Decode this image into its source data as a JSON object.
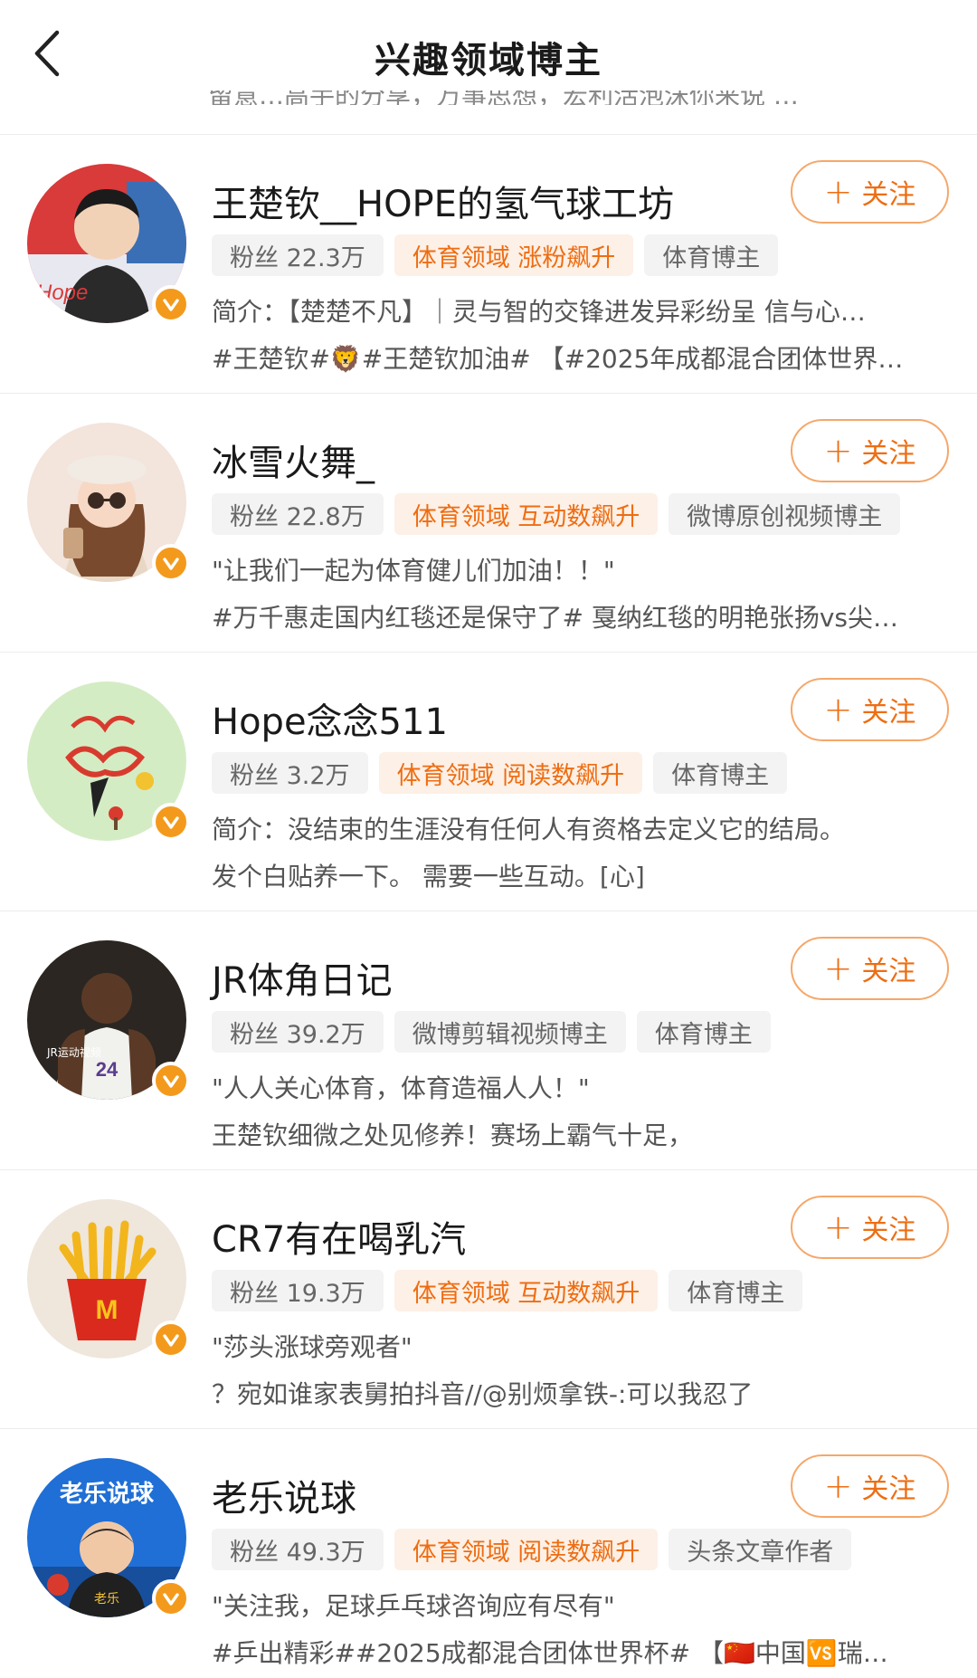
{
  "header": {
    "title": "兴趣领域博主",
    "partial_text": "留意…高手的分享，万事思想，宏利活泡沫你来说 …"
  },
  "follow_label": "关注",
  "accounts": [
    {
      "name": "王楚钦__HOPE的氢气球工坊",
      "fans": "粉丝 22.3万",
      "highlight": "体育领域 涨粉飙升",
      "category": "体育博主",
      "line1": "简介：【楚楚不凡】｜灵与智的交锋进发异彩纷呈 信与心…",
      "line2": "#王楚钦#🦁#王楚钦加油# 【#2025年成都混合团体世界…"
    },
    {
      "name": "冰雪火舞_",
      "fans": "粉丝 22.8万",
      "highlight": "体育领域 互动数飙升",
      "category": "微博原创视频博主",
      "line1": "\"让我们一起为体育健儿们加油！！\"",
      "line2": "#万千惠走国内红毯还是保守了# 戛纳红毯的明艳张扬vs尖…"
    },
    {
      "name": "Hope念念511",
      "fans": "粉丝 3.2万",
      "highlight": "体育领域 阅读数飙升",
      "category": "体育博主",
      "line1": "简介：没结束的生涯没有任何人有资格去定义它的结局。",
      "line2": "发个白贴养一下。 需要一些互动。[心]"
    },
    {
      "name": "JR体角日记",
      "fans": "粉丝 39.2万",
      "highlight": "微博剪辑视频博主",
      "category": "体育博主",
      "line1": "\"人人关心体育，体育造福人人！\"",
      "line2": "王楚钦细微之处见修养！赛场上霸气十足，",
      "avatar_caption": "JR运动视频"
    },
    {
      "name": "CR7有在喝乳汽",
      "fans": "粉丝 19.3万",
      "highlight": "体育领域 互动数飙升",
      "category": "体育博主",
      "line1": "\"莎头涨球旁观者\"",
      "line2": "？宛如谁家表舅拍抖音//@别烦拿铁-:可以我忍了"
    },
    {
      "name": "老乐说球",
      "fans": "粉丝 49.3万",
      "highlight": "体育领域 阅读数飙升",
      "category": "头条文章作者",
      "line1": "\"关注我，足球乒乓球咨询应有尽有\"",
      "line2": "#乒出精彩##2025成都混合团体世界杯# 【🇨🇳中国🆚瑞…",
      "avatar_caption": "老乐说球",
      "avatar_shirt": "老乐"
    }
  ],
  "colors": {
    "accent": "#ee6d12",
    "accent_border": "#f5a76a",
    "tag_bg": "#f3f3f3",
    "hot_tag_bg": "#fdf0e6",
    "verify_badge": "#f39a1c"
  }
}
